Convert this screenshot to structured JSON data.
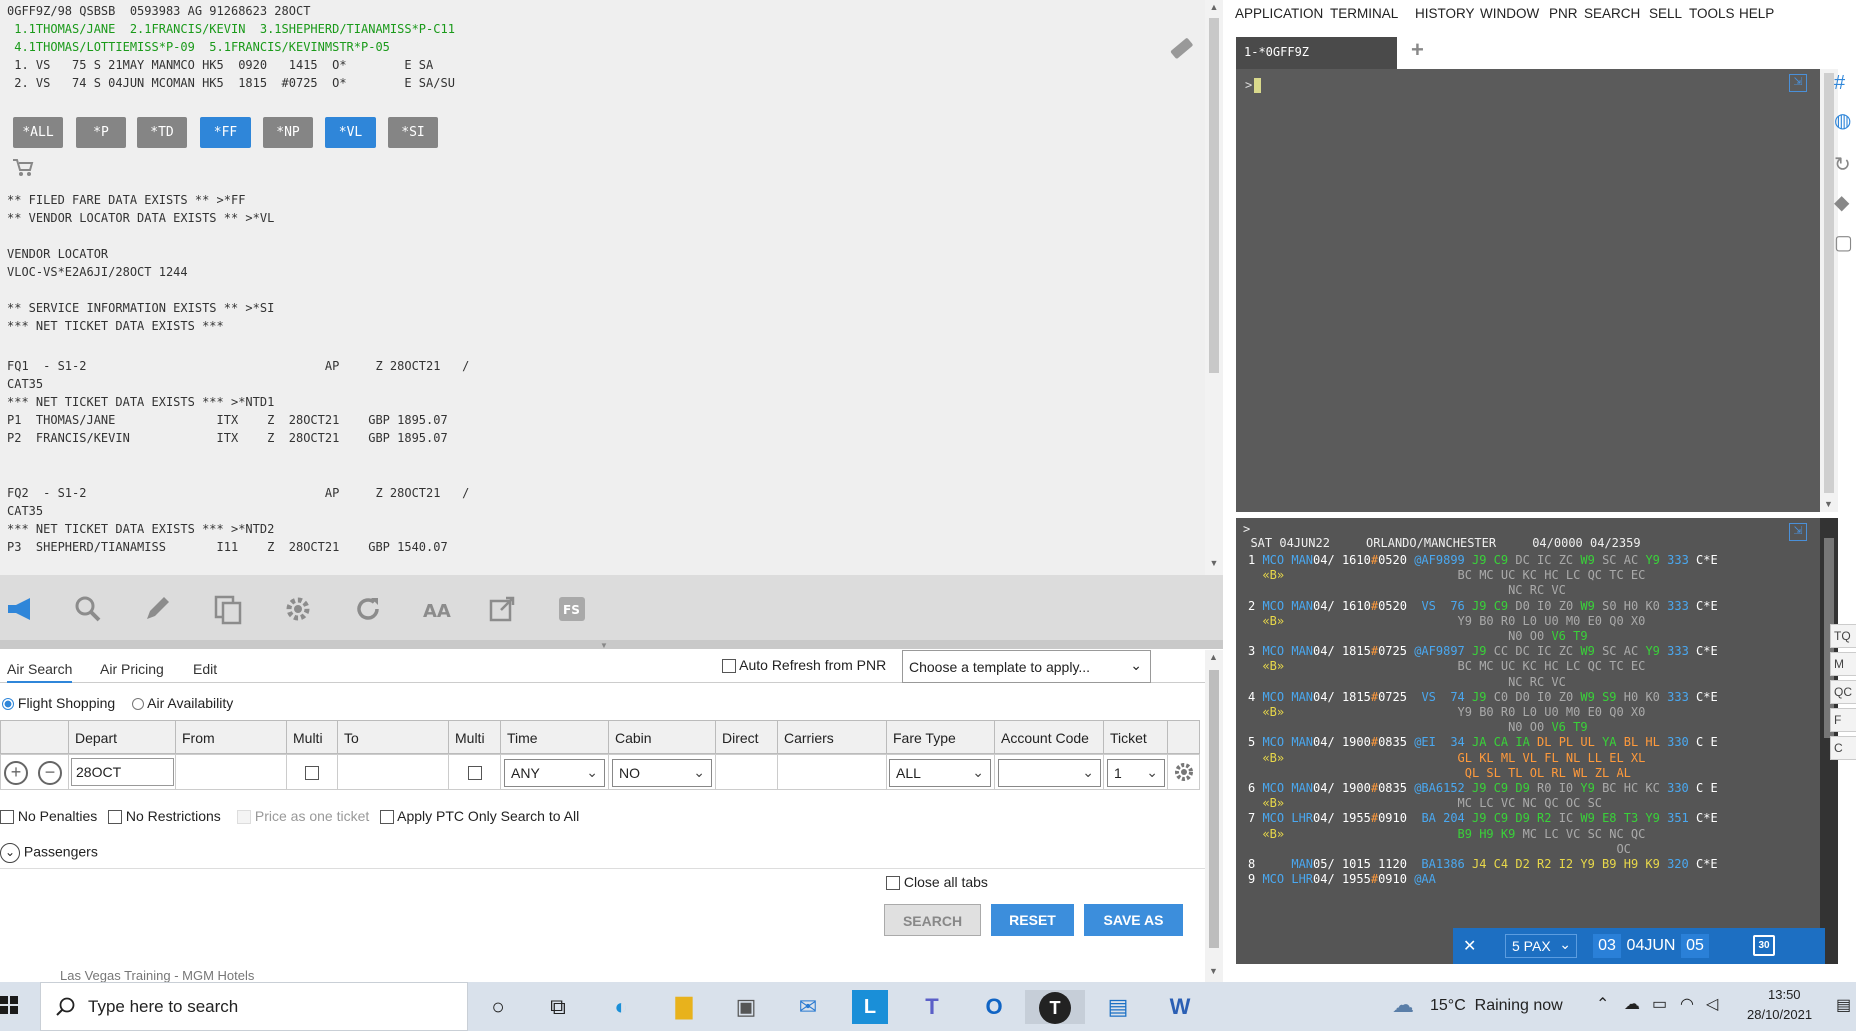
{
  "pnr": {
    "header": "0GFF9Z/98 QSBSB  0593983 AG 91268623 28OCT",
    "names1": " 1.1THOMAS/JANE  2.1FRANCIS/KEVIN  3.1SHEPHERD/TIANAMISS*P-C11",
    "names2": " 4.1THOMAS/LOTTIEMISS*P-09  5.1FRANCIS/KEVINMSTR*P-05",
    "seg1": " 1. VS   75 S 21MAY MANMCO HK5  0920   1415  O*        E SA",
    "seg2": " 2. VS   74 S 04JUN MCOMAN HK5  1815  #0725  O*        E SA/SU",
    "filed_fare": "** FILED FARE DATA EXISTS ** >*FF",
    "vendor_exists": "** VENDOR LOCATOR DATA EXISTS ** >*VL",
    "vendor_locator": "VENDOR LOCATOR",
    "vloc": "VLOC-VS*E2A6JI/28OCT 1244",
    "service_info": "** SERVICE INFORMATION EXISTS ** >*SI",
    "net_ticket": "*** NET TICKET DATA EXISTS ***",
    "fq1": "FQ1  - S1-2                                 AP     Z 28OCT21   /",
    "cat35a": "CAT35",
    "ntd1": "*** NET TICKET DATA EXISTS *** >*NTD1",
    "p1": "P1  THOMAS/JANE              ITX    Z  28OCT21    GBP 1895.07",
    "p2": "P2  FRANCIS/KEVIN            ITX    Z  28OCT21    GBP 1895.07",
    "fq2": "FQ2  - S1-2                                 AP     Z 28OCT21   /",
    "cat35b": "CAT35",
    "ntd2": "*** NET TICKET DATA EXISTS *** >*NTD2",
    "p3": "P3  SHEPHERD/TIANAMISS       I11    Z  28OCT21    GBP 1540.07"
  },
  "chips": [
    "*ALL",
    "*P",
    "*TD",
    "*FF",
    "*NP",
    "*VL",
    "*SI"
  ],
  "form": {
    "tabs": [
      "Air Search",
      "Air Pricing",
      "Edit"
    ],
    "auto_refresh": "Auto Refresh from PNR",
    "template_placeholder": "Choose a template to apply...",
    "mode_flight": "Flight Shopping",
    "mode_avail": "Air Availability",
    "headers": [
      "Depart",
      "From",
      "Multi",
      "To",
      "Multi",
      "Time",
      "Cabin",
      "Direct",
      "Carriers",
      "Fare Type",
      "Account Code",
      "Ticket"
    ],
    "depart_value": "28OCT",
    "time_value": "ANY",
    "cabin_value": "NO",
    "fare_type_value": "ALL",
    "ticket_value": "1",
    "no_penalties": "No Penalties",
    "no_restrictions": "No Restrictions",
    "price_one_ticket": "Price as one ticket",
    "apply_ptc": "Apply PTC Only Search to All",
    "passengers": "Passengers",
    "close_all_tabs": "Close all tabs",
    "search_btn": "SEARCH",
    "reset_btn": "RESET",
    "save_as_btn": "SAVE AS"
  },
  "menu": [
    "APPLICATION",
    "TERMINAL",
    "HISTORY",
    "WINDOW",
    "PNR",
    "SEARCH",
    "SELL",
    "TOOLS",
    "HELP"
  ],
  "terminal": {
    "tab_label": "1-*0GFF9Z",
    "prompt": ">",
    "avail_prompt": ">",
    "avail_header": "  SAT 04JUN22     ORLANDO/MANCHESTER     04/0000 04/2359"
  },
  "avail_rows": [
    [
      {
        "t": "1 ",
        "c": "w"
      },
      {
        "t": "MCO ",
        "c": "bl"
      },
      {
        "t": "MAN",
        "c": "bl"
      },
      {
        "t": "04/ 1610",
        "c": "w"
      },
      {
        "t": "#",
        "c": "o"
      },
      {
        "t": "0520 ",
        "c": "w"
      },
      {
        "t": "@AF9899 ",
        "c": "bl"
      },
      {
        "t": "J9 C9 ",
        "c": "gr"
      },
      {
        "t": "DC IC ZC ",
        "c": "gy"
      },
      {
        "t": "W9 ",
        "c": "gr"
      },
      {
        "t": "SC AC ",
        "c": "gy"
      },
      {
        "t": "Y9 ",
        "c": "gr"
      },
      {
        "t": "333 ",
        "c": "bl"
      },
      {
        "t": "C*E",
        "c": "w"
      }
    ],
    [
      {
        "t": "  ",
        "c": "w"
      },
      {
        "t": "«B»",
        "c": "y"
      },
      {
        "t": "                        BC MC UC KC HC LC QC TC EC",
        "c": "gy"
      }
    ],
    [
      {
        "t": "                                    NC RC VC",
        "c": "gy"
      }
    ],
    [
      {
        "t": "2 ",
        "c": "w"
      },
      {
        "t": "MCO ",
        "c": "bl"
      },
      {
        "t": "MAN",
        "c": "bl"
      },
      {
        "t": "04/ 1610",
        "c": "w"
      },
      {
        "t": "#",
        "c": "o"
      },
      {
        "t": "0520  ",
        "c": "w"
      },
      {
        "t": "VS  76 ",
        "c": "bl"
      },
      {
        "t": "J9 C9 ",
        "c": "gr"
      },
      {
        "t": "D0 I0 Z0 ",
        "c": "gy"
      },
      {
        "t": "W9 ",
        "c": "gr"
      },
      {
        "t": "S0 H0 K0 ",
        "c": "gy"
      },
      {
        "t": "333 ",
        "c": "bl"
      },
      {
        "t": "C*E",
        "c": "w"
      }
    ],
    [
      {
        "t": "  ",
        "c": "w"
      },
      {
        "t": "«B»",
        "c": "y"
      },
      {
        "t": "                        Y9 B0 R0 L0 U0 M0 E0 Q0 X0",
        "c": "gy"
      }
    ],
    [
      {
        "t": "                                    N0 O0 ",
        "c": "gy"
      },
      {
        "t": "V6 T9",
        "c": "gr"
      }
    ],
    [
      {
        "t": "3 ",
        "c": "w"
      },
      {
        "t": "MCO ",
        "c": "bl"
      },
      {
        "t": "MAN",
        "c": "bl"
      },
      {
        "t": "04/ 1815",
        "c": "w"
      },
      {
        "t": "#",
        "c": "o"
      },
      {
        "t": "0725 ",
        "c": "w"
      },
      {
        "t": "@AF9897 ",
        "c": "bl"
      },
      {
        "t": "J9 ",
        "c": "gr"
      },
      {
        "t": "CC DC IC ZC ",
        "c": "gy"
      },
      {
        "t": "W9 ",
        "c": "gr"
      },
      {
        "t": "SC AC ",
        "c": "gy"
      },
      {
        "t": "Y9 ",
        "c": "gr"
      },
      {
        "t": "333 ",
        "c": "bl"
      },
      {
        "t": "C*E",
        "c": "w"
      }
    ],
    [
      {
        "t": "  ",
        "c": "w"
      },
      {
        "t": "«B»",
        "c": "y"
      },
      {
        "t": "                        BC MC UC KC HC LC QC TC EC",
        "c": "gy"
      }
    ],
    [
      {
        "t": "                                    NC RC VC",
        "c": "gy"
      }
    ],
    [
      {
        "t": "4 ",
        "c": "w"
      },
      {
        "t": "MCO ",
        "c": "bl"
      },
      {
        "t": "MAN",
        "c": "bl"
      },
      {
        "t": "04/ 1815",
        "c": "w"
      },
      {
        "t": "#",
        "c": "o"
      },
      {
        "t": "0725  ",
        "c": "w"
      },
      {
        "t": "VS  74 ",
        "c": "bl"
      },
      {
        "t": "J9 ",
        "c": "gr"
      },
      {
        "t": "C0 D0 I0 Z0 ",
        "c": "gy"
      },
      {
        "t": "W9 S9 ",
        "c": "gr"
      },
      {
        "t": "H0 K0 ",
        "c": "gy"
      },
      {
        "t": "333 ",
        "c": "bl"
      },
      {
        "t": "C*E",
        "c": "w"
      }
    ],
    [
      {
        "t": "  ",
        "c": "w"
      },
      {
        "t": "«B»",
        "c": "y"
      },
      {
        "t": "                        Y9 B0 R0 L0 U0 M0 E0 Q0 X0",
        "c": "gy"
      }
    ],
    [
      {
        "t": "                                    N0 O0 ",
        "c": "gy"
      },
      {
        "t": "V6 T9",
        "c": "gr"
      }
    ],
    [
      {
        "t": "5 ",
        "c": "w"
      },
      {
        "t": "MCO ",
        "c": "bl"
      },
      {
        "t": "MAN",
        "c": "bl"
      },
      {
        "t": "04/ 1900",
        "c": "w"
      },
      {
        "t": "#",
        "c": "o"
      },
      {
        "t": "0835 ",
        "c": "w"
      },
      {
        "t": "@EI  34 ",
        "c": "bl"
      },
      {
        "t": "JA CA IA ",
        "c": "gr"
      },
      {
        "t": "DL PL UL ",
        "c": "o"
      },
      {
        "t": "YA ",
        "c": "gr"
      },
      {
        "t": "BL HL ",
        "c": "o"
      },
      {
        "t": "330 ",
        "c": "bl"
      },
      {
        "t": "C E",
        "c": "w"
      }
    ],
    [
      {
        "t": "  ",
        "c": "w"
      },
      {
        "t": "«B»",
        "c": "y"
      },
      {
        "t": "                        GL KL ML VL FL NL LL EL XL",
        "c": "o"
      }
    ],
    [
      {
        "t": "                              QL SL TL OL RL WL ZL AL",
        "c": "o"
      }
    ],
    [
      {
        "t": "6 ",
        "c": "w"
      },
      {
        "t": "MCO ",
        "c": "bl"
      },
      {
        "t": "MAN",
        "c": "bl"
      },
      {
        "t": "04/ 1900",
        "c": "w"
      },
      {
        "t": "#",
        "c": "o"
      },
      {
        "t": "0835 ",
        "c": "w"
      },
      {
        "t": "@BA6152 ",
        "c": "bl"
      },
      {
        "t": "J9 C9 D9 ",
        "c": "gr"
      },
      {
        "t": "R0 I0 ",
        "c": "gy"
      },
      {
        "t": "Y9 ",
        "c": "gr"
      },
      {
        "t": "BC HC KC ",
        "c": "gy"
      },
      {
        "t": "330 ",
        "c": "bl"
      },
      {
        "t": "C E",
        "c": "w"
      }
    ],
    [
      {
        "t": "  ",
        "c": "w"
      },
      {
        "t": "«B»",
        "c": "y"
      },
      {
        "t": "                        MC LC VC NC QC OC SC",
        "c": "gy"
      }
    ],
    [
      {
        "t": "7 ",
        "c": "w"
      },
      {
        "t": "MCO ",
        "c": "bl"
      },
      {
        "t": "LHR",
        "c": "bl"
      },
      {
        "t": "04/ 1955",
        "c": "w"
      },
      {
        "t": "#",
        "c": "o"
      },
      {
        "t": "0910  ",
        "c": "w"
      },
      {
        "t": "BA 204 ",
        "c": "bl"
      },
      {
        "t": "J9 C9 D9 R2 ",
        "c": "gr"
      },
      {
        "t": "IC ",
        "c": "gy"
      },
      {
        "t": "W9 E8 T3 Y9 ",
        "c": "gr"
      },
      {
        "t": "351 ",
        "c": "bl"
      },
      {
        "t": "C*E",
        "c": "w"
      }
    ],
    [
      {
        "t": "  ",
        "c": "w"
      },
      {
        "t": "«B»",
        "c": "y"
      },
      {
        "t": "                        B9 H9 K9 ",
        "c": "gr"
      },
      {
        "t": "MC LC VC SC NC QC",
        "c": "gy"
      }
    ],
    [
      {
        "t": "                                                   OC",
        "c": "gy"
      }
    ],
    [
      {
        "t": "8     ",
        "c": "w"
      },
      {
        "t": "MAN",
        "c": "bl"
      },
      {
        "t": "05/ 1015 1120  ",
        "c": "w"
      },
      {
        "t": "BA1386 ",
        "c": "bl"
      },
      {
        "t": "J4 C4 D2 R2 I2 Y9 B9 H9 K9 ",
        "c": "y"
      },
      {
        "t": "320 ",
        "c": "bl"
      },
      {
        "t": "C*E",
        "c": "w"
      }
    ],
    [
      {
        "t": "9 ",
        "c": "w"
      },
      {
        "t": "MCO ",
        "c": "bl"
      },
      {
        "t": "LHR",
        "c": "bl"
      },
      {
        "t": "04/ 1955",
        "c": "w"
      },
      {
        "t": "#",
        "c": "o"
      },
      {
        "t": "0910 ",
        "c": "w"
      },
      {
        "t": "@AA",
        "c": "bl"
      }
    ]
  ],
  "paxbar": {
    "close": "✕",
    "pax": "5 PAX",
    "day": "03",
    "date": "04JUN",
    "day2": "05",
    "cal": "30"
  },
  "rail_buttons": [
    "TQ",
    "M",
    "QC",
    "F",
    "C"
  ],
  "taskbar": {
    "search_placeholder": "Type here to search",
    "weather": "15°C  Raining now",
    "time": "13:50",
    "date": "28/10/2021",
    "partial_window": "Las Vegas Training - MGM Hotels"
  }
}
